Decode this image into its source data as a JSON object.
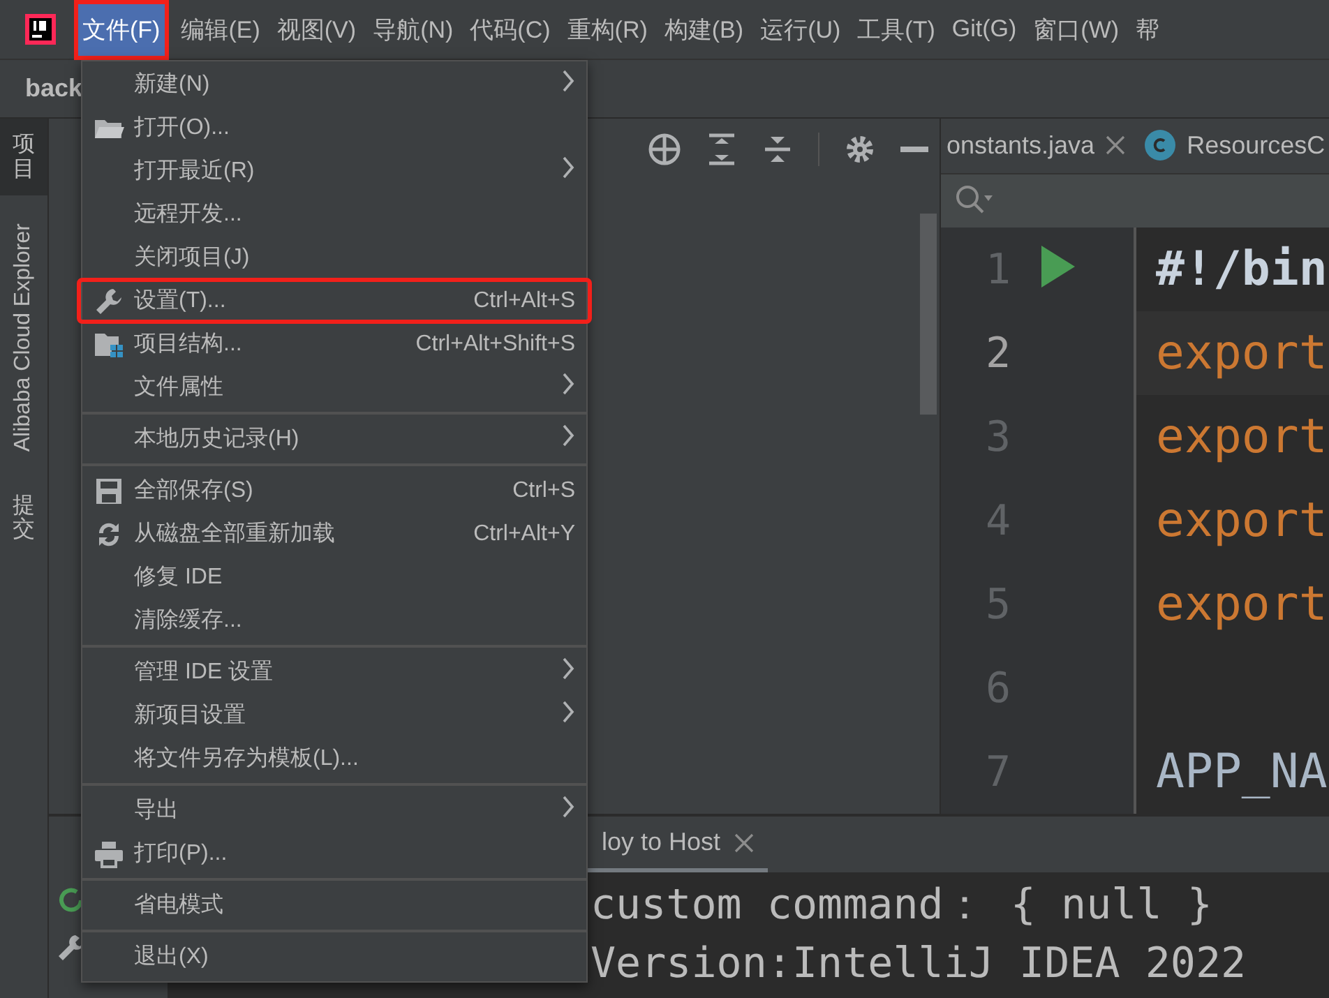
{
  "menubar": [
    {
      "label": "文件(F)",
      "selected": true,
      "annotated": true
    },
    {
      "label": "编辑(E)",
      "selected": false,
      "annotated": false
    },
    {
      "label": "视图(V)",
      "selected": false,
      "annotated": false
    },
    {
      "label": "导航(N)",
      "selected": false,
      "annotated": false
    },
    {
      "label": "代码(C)",
      "selected": false,
      "annotated": false
    },
    {
      "label": "重构(R)",
      "selected": false,
      "annotated": false
    },
    {
      "label": "构建(B)",
      "selected": false,
      "annotated": false
    },
    {
      "label": "运行(U)",
      "selected": false,
      "annotated": false
    },
    {
      "label": "工具(T)",
      "selected": false,
      "annotated": false
    },
    {
      "label": "Git(G)",
      "selected": false,
      "annotated": false
    },
    {
      "label": "窗口(W)",
      "selected": false,
      "annotated": false
    },
    {
      "label": "帮",
      "selected": false,
      "annotated": false
    }
  ],
  "project_title": "back",
  "tool_strip": [
    {
      "label": "项目",
      "kind": "cjk",
      "selected": true
    },
    {
      "label": "Alibaba Cloud Explorer",
      "kind": "latin",
      "selected": false
    },
    {
      "label": "提交",
      "kind": "cjk",
      "selected": false
    }
  ],
  "editor": {
    "tabs": [
      {
        "label": "onstants.java",
        "kind": "file",
        "closable": true
      },
      {
        "label": "ResourcesC",
        "kind": "class",
        "closable": false
      }
    ],
    "lines": [
      {
        "number": "1",
        "code": "#!/bin",
        "kind": "shebang",
        "run": true,
        "current": false
      },
      {
        "number": "2",
        "code": "export",
        "kind": "keyword",
        "run": false,
        "current": true
      },
      {
        "number": "3",
        "code": "export",
        "kind": "keyword",
        "run": false,
        "current": false
      },
      {
        "number": "4",
        "code": "export",
        "kind": "keyword",
        "run": false,
        "current": false
      },
      {
        "number": "5",
        "code": "export",
        "kind": "keyword",
        "run": false,
        "current": false
      },
      {
        "number": "6",
        "kind": "plain",
        "run": false,
        "current": false
      },
      {
        "number": "7",
        "code": "APP_NA",
        "kind": "plain",
        "run": false,
        "current": false
      }
    ]
  },
  "run_panel": {
    "tab": {
      "label": "loy to Host",
      "closable": true
    },
    "console": [
      "custom command： { null }",
      "Version:IntelliJ IDEA 2022"
    ]
  },
  "file_menu": [
    {
      "kind": "plain",
      "label": "新建(N)",
      "submenu": true,
      "annotated": false
    },
    {
      "kind": "folder",
      "label": "打开(O)...",
      "submenu": false,
      "annotated": false
    },
    {
      "kind": "plain",
      "label": "打开最近(R)",
      "submenu": true,
      "annotated": false
    },
    {
      "kind": "plain",
      "label": "远程开发...",
      "submenu": false,
      "annotated": false
    },
    {
      "kind": "plain",
      "label": "关闭项目(J)",
      "submenu": false,
      "annotated": false
    },
    {
      "kind": "wrench",
      "label": "设置(T)...",
      "shortcut": "Ctrl+Alt+S",
      "submenu": false,
      "annotated": true
    },
    {
      "kind": "structure",
      "label": "项目结构...",
      "shortcut": "Ctrl+Alt+Shift+S",
      "submenu": false,
      "annotated": false
    },
    {
      "kind": "plain",
      "label": "文件属性",
      "submenu": true,
      "annotated": false
    },
    {
      "kind": "separator"
    },
    {
      "kind": "plain",
      "label": "本地历史记录(H)",
      "submenu": true,
      "annotated": false
    },
    {
      "kind": "separator"
    },
    {
      "kind": "save",
      "label": "全部保存(S)",
      "shortcut": "Ctrl+S",
      "submenu": false,
      "annotated": false
    },
    {
      "kind": "reload",
      "label": "从磁盘全部重新加载",
      "shortcut": "Ctrl+Alt+Y",
      "submenu": false,
      "annotated": false
    },
    {
      "kind": "plain",
      "label": "修复 IDE",
      "submenu": false,
      "annotated": false
    },
    {
      "kind": "plain",
      "label": "清除缓存...",
      "submenu": false,
      "annotated": false
    },
    {
      "kind": "separator"
    },
    {
      "kind": "plain",
      "label": "管理 IDE 设置",
      "submenu": true,
      "annotated": false
    },
    {
      "kind": "plain",
      "label": "新项目设置",
      "submenu": true,
      "annotated": false
    },
    {
      "kind": "plain",
      "label": "将文件另存为模板(L)...",
      "submenu": false,
      "annotated": false
    },
    {
      "kind": "separator"
    },
    {
      "kind": "plain",
      "label": "导出",
      "submenu": true,
      "annotated": false
    },
    {
      "kind": "printer",
      "label": "打印(P)...",
      "submenu": false,
      "annotated": false
    },
    {
      "kind": "separator"
    },
    {
      "kind": "plain",
      "label": "省电模式",
      "submenu": false,
      "annotated": false
    },
    {
      "kind": "separator"
    },
    {
      "kind": "plain",
      "label": "退出(X)",
      "submenu": false,
      "annotated": false
    }
  ]
}
